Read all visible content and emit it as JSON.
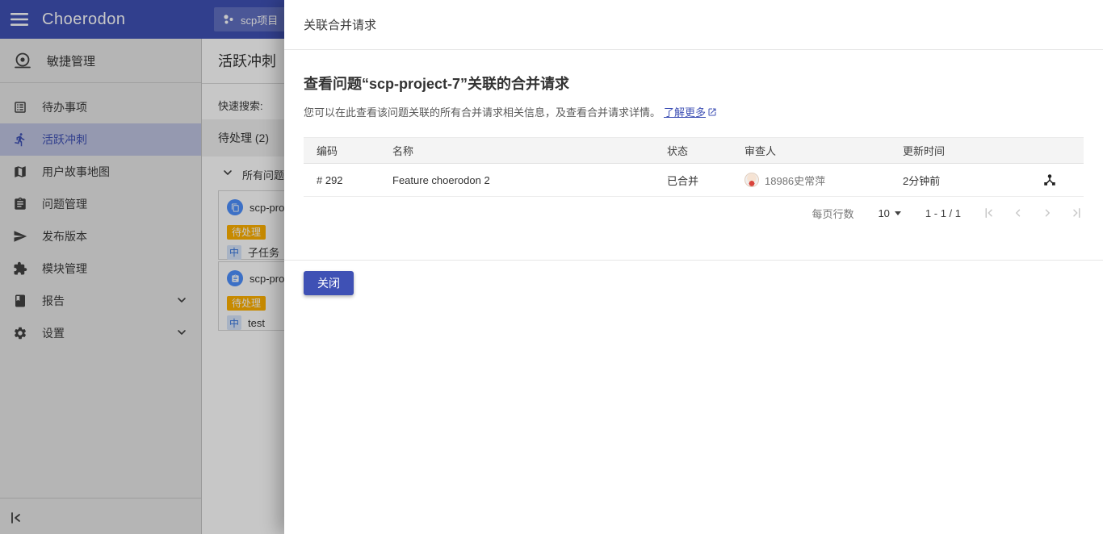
{
  "colors": {
    "accent": "#3F51B5",
    "status_badge": "#FFB100",
    "priority_chip_text": "#3575DE",
    "issue_type_icon": "#4D90FE",
    "link": "#3F51B5"
  },
  "topbar": {
    "brand": "Choerodon",
    "project_button": "scp项目"
  },
  "sidebar": {
    "section": "敏捷管理",
    "items": [
      {
        "label": "待办事项",
        "icon": "backlog-icon",
        "selected": false
      },
      {
        "label": "活跃冲刺",
        "icon": "sprint-icon",
        "selected": true
      },
      {
        "label": "用户故事地图",
        "icon": "storymap-icon",
        "selected": false
      },
      {
        "label": "问题管理",
        "icon": "issue-icon",
        "selected": false
      },
      {
        "label": "发布版本",
        "icon": "release-icon",
        "selected": false
      },
      {
        "label": "模块管理",
        "icon": "module-icon",
        "selected": false
      },
      {
        "label": "报告",
        "icon": "report-icon",
        "selected": false,
        "expandable": true
      },
      {
        "label": "设置",
        "icon": "settings-icon",
        "selected": false,
        "expandable": true
      }
    ]
  },
  "board": {
    "title": "活跃冲刺",
    "quick_search_label": "快速搜索:",
    "column_header": "待处理 (2)",
    "group_label": "所有问题",
    "cards": [
      {
        "code": "scp-pro",
        "status": "待处理",
        "priority": "中",
        "summary": "子任务",
        "type": "subtask-icon"
      },
      {
        "code": "scp-pro",
        "status": "待处理",
        "priority": "中",
        "summary": "test",
        "type": "task-icon"
      }
    ]
  },
  "modal": {
    "title": "关联合并请求",
    "heading": "查看问题“scp-project-7”关联的合并请求",
    "description": "您可以在此查看该问题关联的所有合并请求相关信息，及查看合并请求详情。",
    "learn_more": "了解更多",
    "table": {
      "columns": [
        "编码",
        "名称",
        "状态",
        "审查人",
        "更新时间"
      ],
      "rows": [
        {
          "code": "# 292",
          "name": "Feature choerodon 2",
          "status": "已合并",
          "reviewer": "18986史常萍",
          "updated": "2分钟前"
        }
      ]
    },
    "pagination": {
      "rows_per_page_label": "每页行数",
      "rows_per_page": "10",
      "range": "1 - 1 / 1"
    },
    "close_label": "关闭"
  }
}
